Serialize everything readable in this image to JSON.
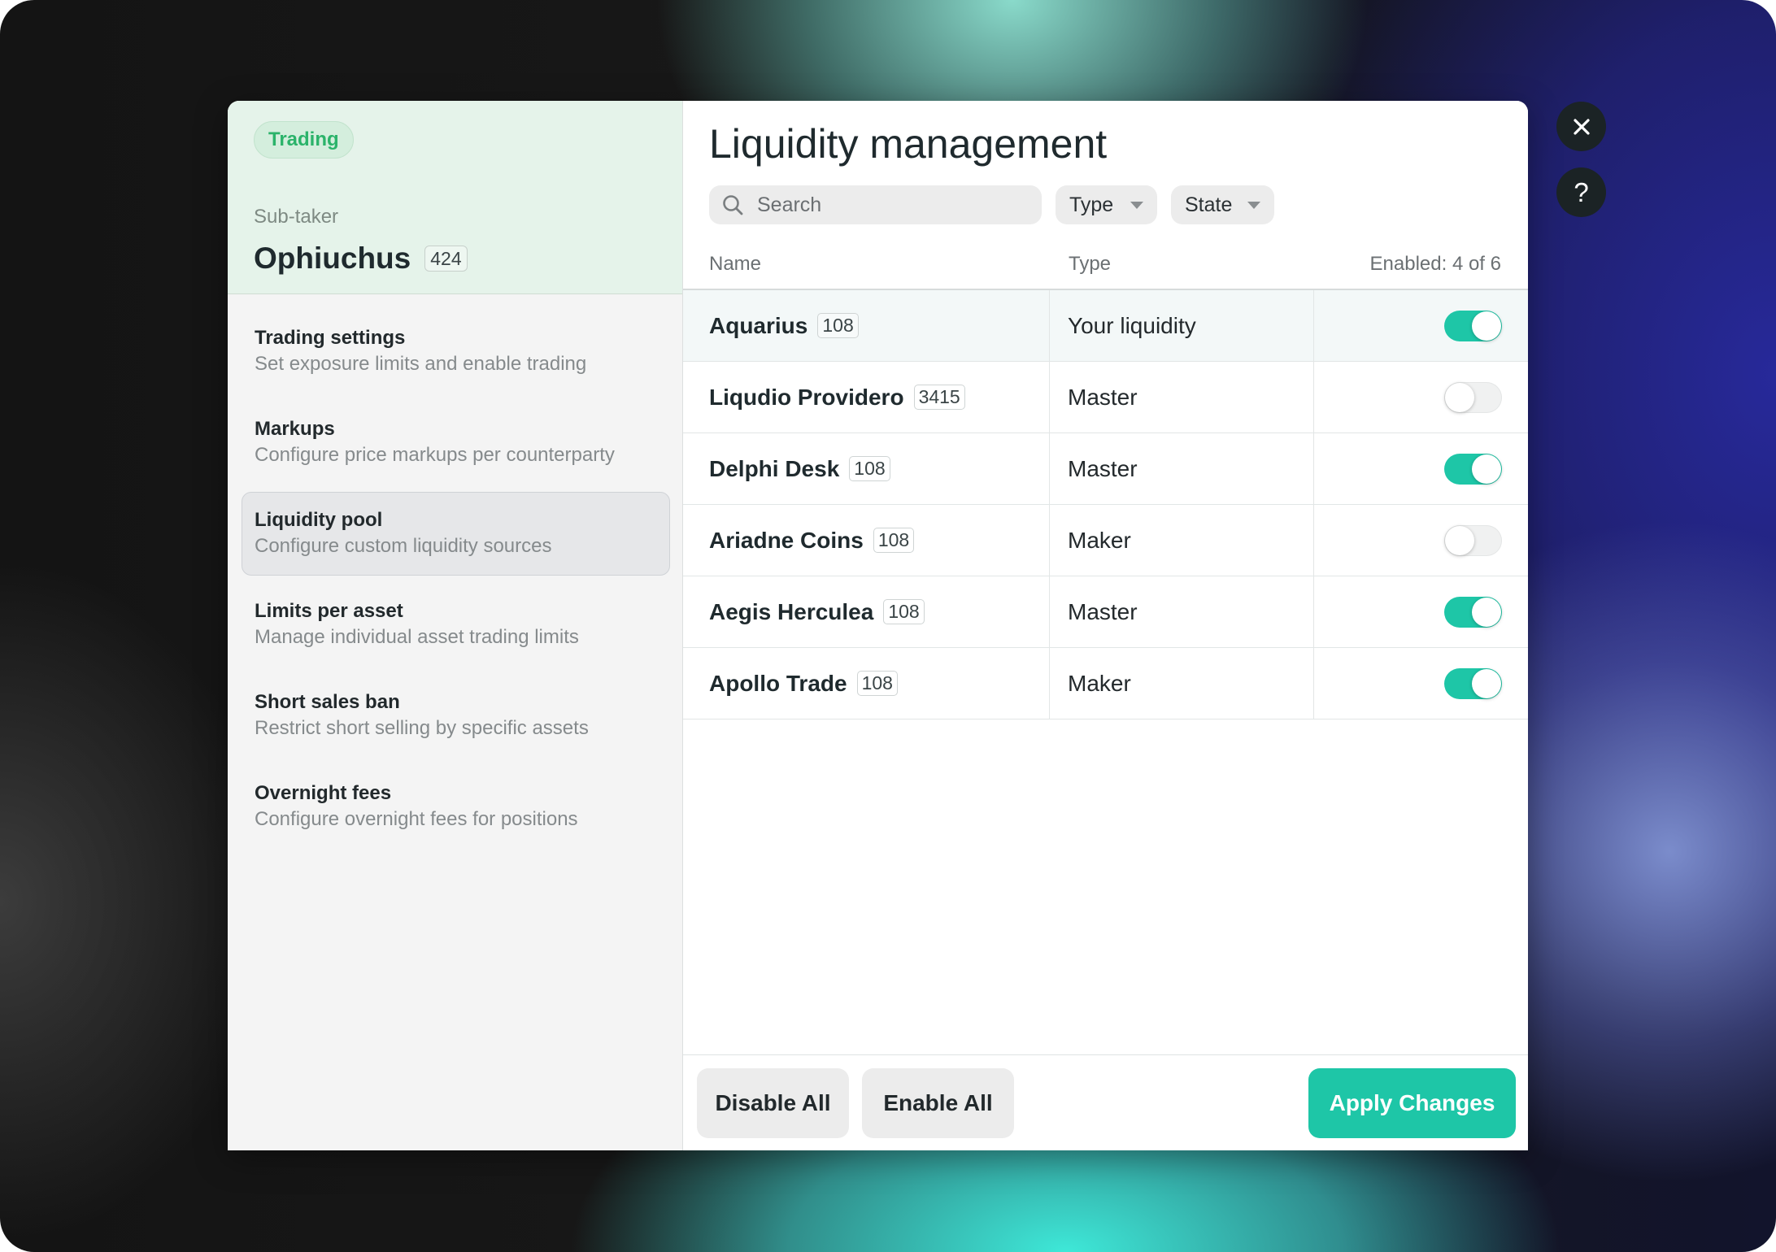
{
  "theme": {
    "accent": "#1ec6a7",
    "tag_color": "#2bb36a"
  },
  "sidebar": {
    "badge": "Trading",
    "subtitle": "Sub-taker",
    "name": "Ophiuchus",
    "name_count": "424",
    "items": [
      {
        "title": "Trading settings",
        "desc": "Set exposure limits and enable trading",
        "selected": false
      },
      {
        "title": "Markups",
        "desc": "Configure price markups per counterparty",
        "selected": false
      },
      {
        "title": "Liquidity pool",
        "desc": "Configure custom liquidity sources",
        "selected": true
      },
      {
        "title": "Limits per asset",
        "desc": "Manage individual asset trading limits",
        "selected": false
      },
      {
        "title": "Short sales ban",
        "desc": "Restrict short selling by specific assets",
        "selected": false
      },
      {
        "title": "Overnight fees",
        "desc": "Configure overnight fees for positions",
        "selected": false
      }
    ]
  },
  "main": {
    "title": "Liquidity management",
    "search": {
      "placeholder": "Search",
      "icon": "search-icon"
    },
    "filters": [
      {
        "label": "Type",
        "icon": "chevron-down-icon"
      },
      {
        "label": "State",
        "icon": "chevron-down-icon"
      }
    ],
    "table": {
      "headers": {
        "name": "Name",
        "type": "Type",
        "enabled": "Enabled: 4 of 6"
      },
      "rows": [
        {
          "name": "Aquarius",
          "count": "108",
          "type": "Your liquidity",
          "enabled": true
        },
        {
          "name": "Liqudio Providero",
          "count": "3415",
          "type": "Master",
          "enabled": false
        },
        {
          "name": "Delphi Desk",
          "count": "108",
          "type": "Master",
          "enabled": true
        },
        {
          "name": "Ariadne Coins",
          "count": "108",
          "type": "Maker",
          "enabled": false
        },
        {
          "name": "Aegis Herculea",
          "count": "108",
          "type": "Master",
          "enabled": true
        },
        {
          "name": "Apollo Trade",
          "count": "108",
          "type": "Maker",
          "enabled": true
        }
      ]
    },
    "footer": {
      "disable_all": "Disable All",
      "enable_all": "Enable All",
      "apply": "Apply Changes"
    }
  },
  "window_controls": {
    "close_icon": "close-icon",
    "help_label": "?"
  }
}
